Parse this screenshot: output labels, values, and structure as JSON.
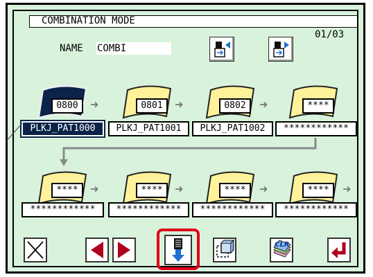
{
  "screen": {
    "title": "COMBINATION MODE",
    "page_indicator": "01/03",
    "name_label": "NAME",
    "name_value": "COMBI"
  },
  "row1": [
    {
      "code": "0800",
      "label": "PLKJ_PAT1000",
      "selected": true
    },
    {
      "code": "0801",
      "label": "PLKJ_PAT1001",
      "selected": false
    },
    {
      "code": "0802",
      "label": "PLKJ_PAT1002",
      "selected": false
    },
    {
      "code": "****",
      "label": "************",
      "selected": false
    }
  ],
  "row2": [
    {
      "code": "****",
      "label": "************"
    },
    {
      "code": "****",
      "label": "************"
    },
    {
      "code": "****",
      "label": "************"
    },
    {
      "code": "****",
      "label": "************"
    }
  ],
  "toolbar": {
    "clr_label": "CLR",
    "icons": [
      "close-icon",
      "arrow-left-icon",
      "arrow-right-icon",
      "insert-down-icon",
      "copy-icon",
      "clear-icon",
      "enter-icon"
    ]
  },
  "colors": {
    "background": "#d9f2dc",
    "selected": "#0b2348",
    "flag": "#fff29a",
    "highlight": "#e0001a"
  }
}
